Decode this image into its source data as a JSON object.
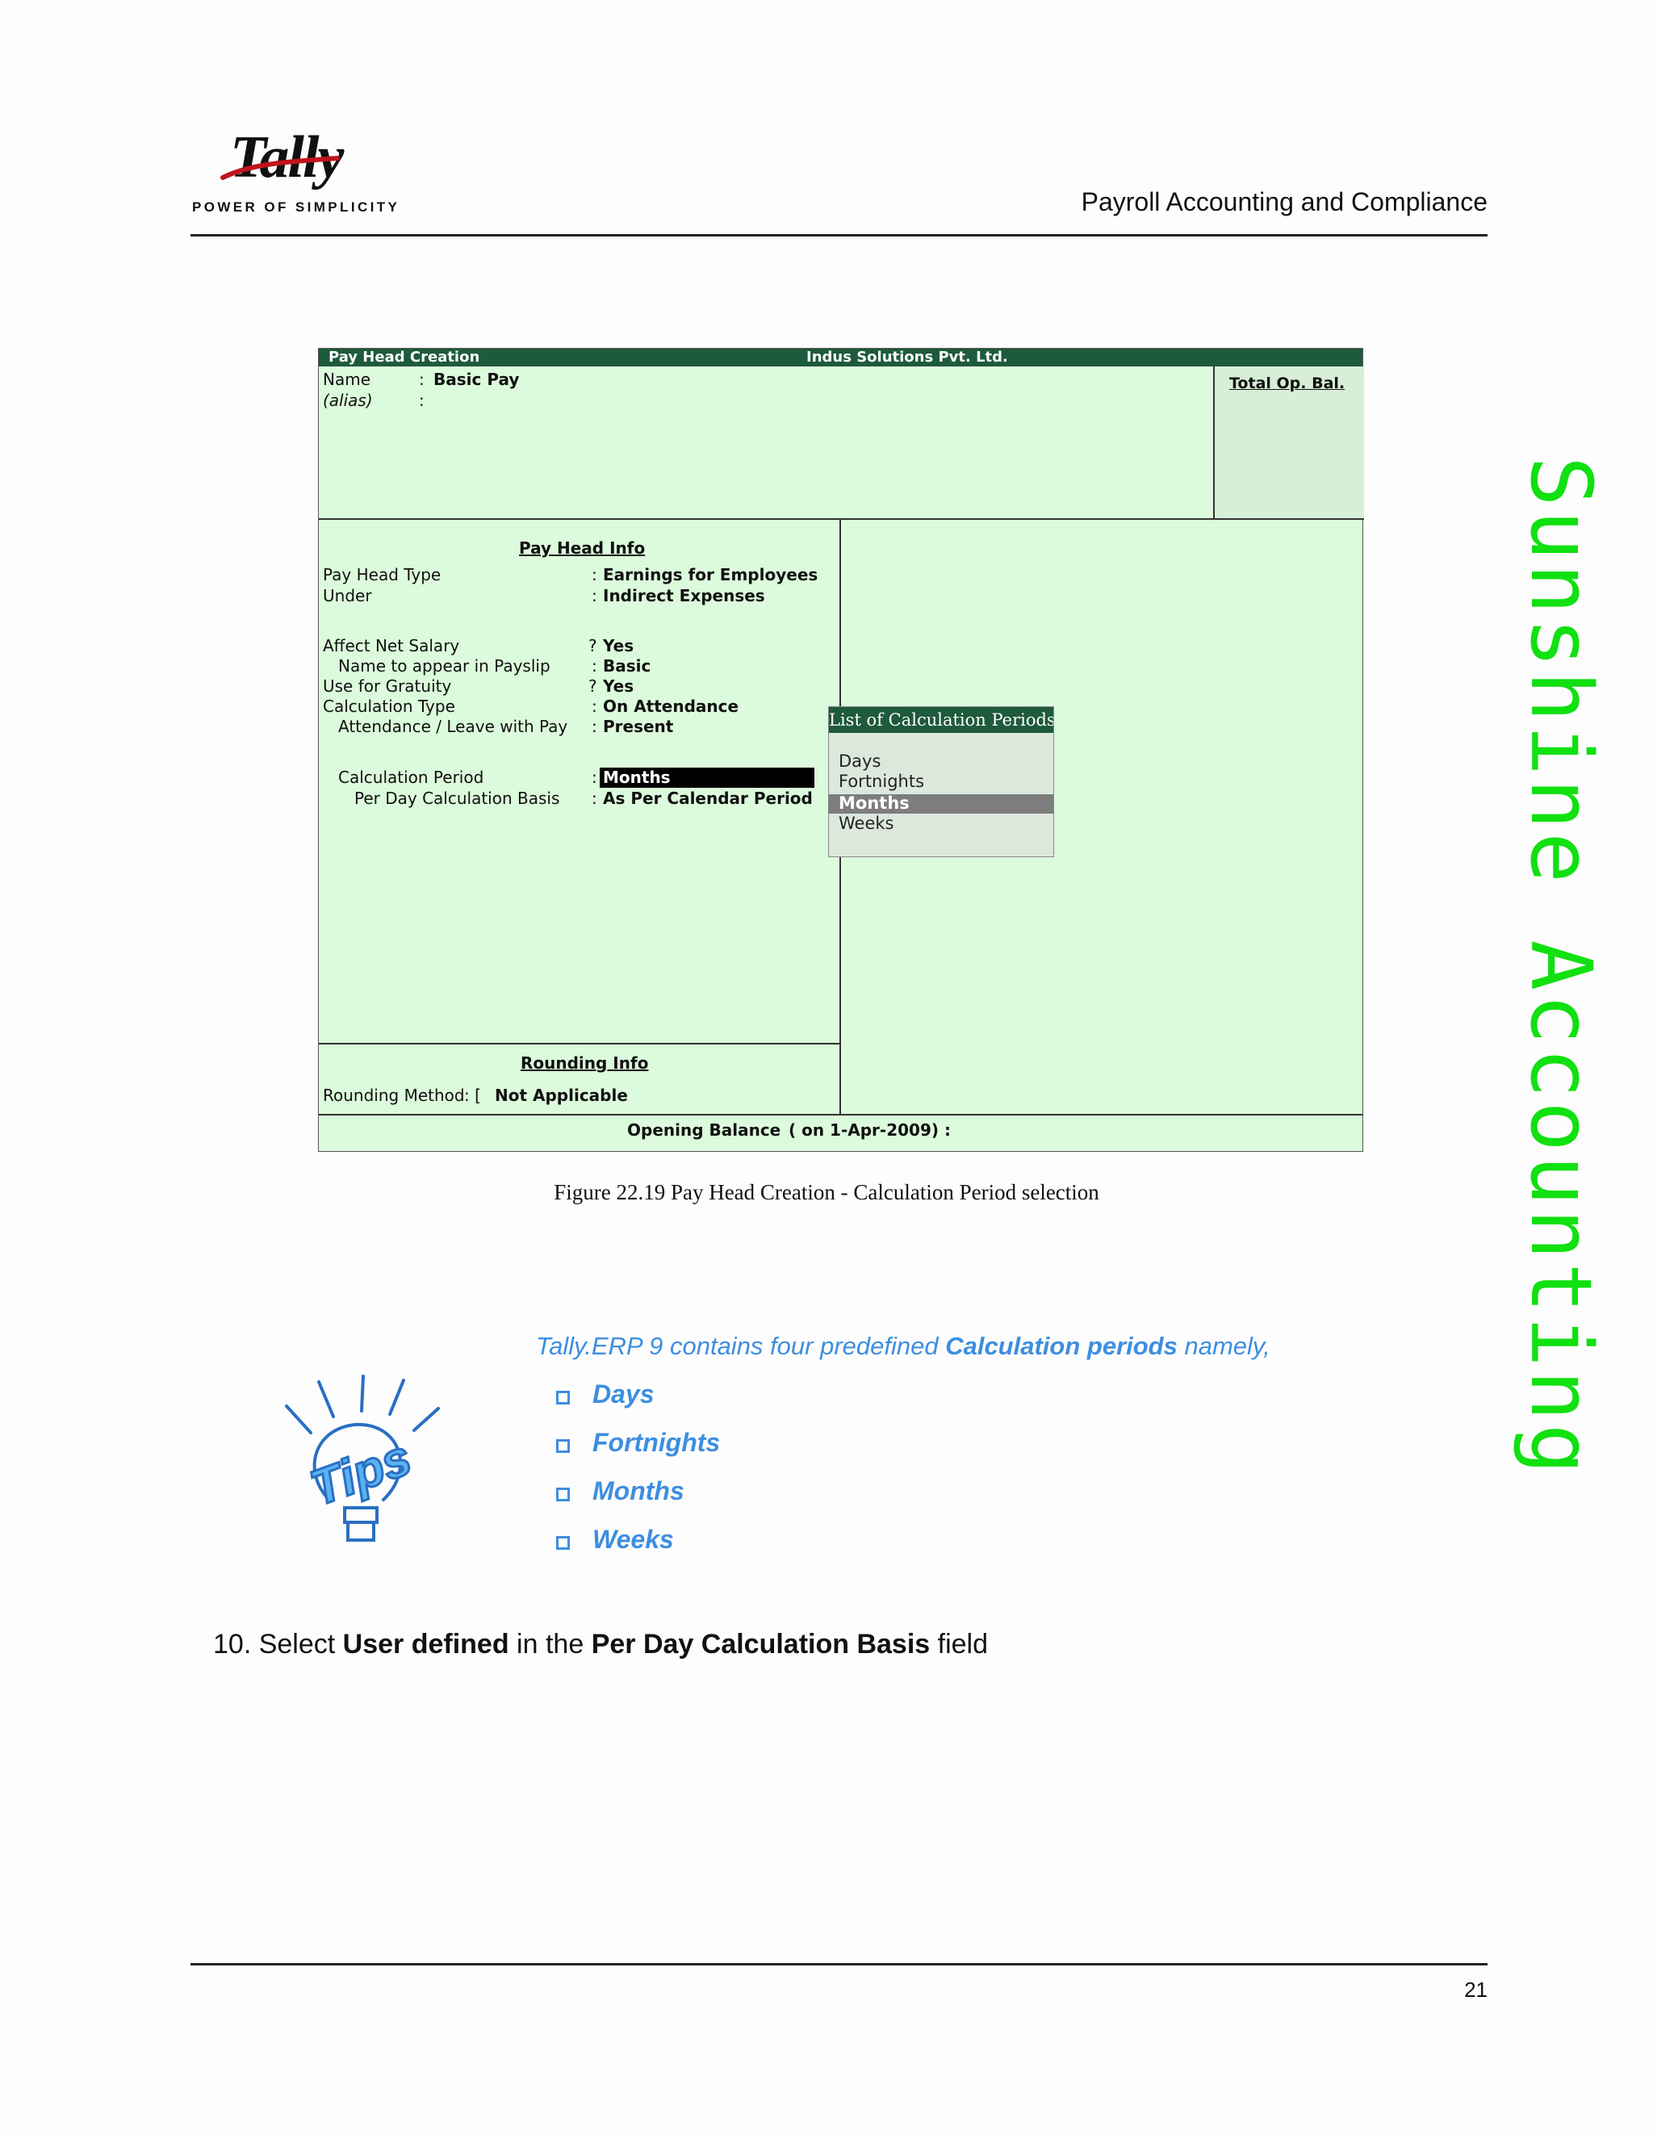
{
  "header": {
    "logo_text": "Tally",
    "logo_tagline": "POWER OF SIMPLICITY",
    "title": "Payroll Accounting and Compliance"
  },
  "screen": {
    "title": "Pay Head  Creation",
    "company": "Indus Solutions Pvt. Ltd.",
    "total_op_bal_label": "Total Op. Bal.",
    "name_label": "Name",
    "name_value": "Basic Pay",
    "alias_label": "(alias)",
    "pay_head_info_title": "Pay Head Info",
    "fields": [
      {
        "label": "Pay Head Type",
        "sep": ":",
        "value": "Earnings for Employees"
      },
      {
        "label": "Under",
        "sep": ":",
        "value": "Indirect Expenses"
      },
      {
        "label": "Affect Net Salary",
        "sep": "?",
        "value": "Yes"
      },
      {
        "label": "Name to appear in Payslip",
        "sep": ":",
        "value": "Basic"
      },
      {
        "label": "Use for Gratuity",
        "sep": "?",
        "value": "Yes"
      },
      {
        "label": "Calculation Type",
        "sep": ":",
        "value": "On Attendance"
      },
      {
        "label": "Attendance / Leave with Pay",
        "sep": ":",
        "value": "Present"
      },
      {
        "label": "Calculation Period",
        "sep": ":",
        "value": "Months"
      },
      {
        "label": "Per Day Calculation Basis",
        "sep": ":",
        "value": "As Per Calendar Period"
      }
    ],
    "rounding_info_title": "Rounding Info",
    "rounding_method_label": "Rounding Method",
    "rounding_method_value": "Not Applicable",
    "opening_balance_label": "Opening Balance",
    "opening_balance_date": "( on 1-Apr-2009) :",
    "popup": {
      "title": "List of Calculation Periods",
      "items": [
        "Days",
        "Fortnights",
        "Months",
        "Weeks"
      ],
      "selected": "Months"
    }
  },
  "caption": "Figure 22.19  Pay Head Creation - Calculation Period selection",
  "tips": {
    "icon_text": "Tips",
    "intro_prefix": "Tally.ERP 9 contains four predefined ",
    "intro_bold": "Calculation periods",
    "intro_suffix": " namely,",
    "items": [
      "Days",
      "Fortnights",
      "Months",
      "Weeks"
    ],
    "color": "#3d8ee0"
  },
  "step": {
    "prefix": "10. Select ",
    "bold1": "User defined",
    "middle": " in the ",
    "bold2": "Per Day Calculation Basis",
    "suffix": " field"
  },
  "side_watermark": "Sunshine Accounting",
  "page_number": "21"
}
